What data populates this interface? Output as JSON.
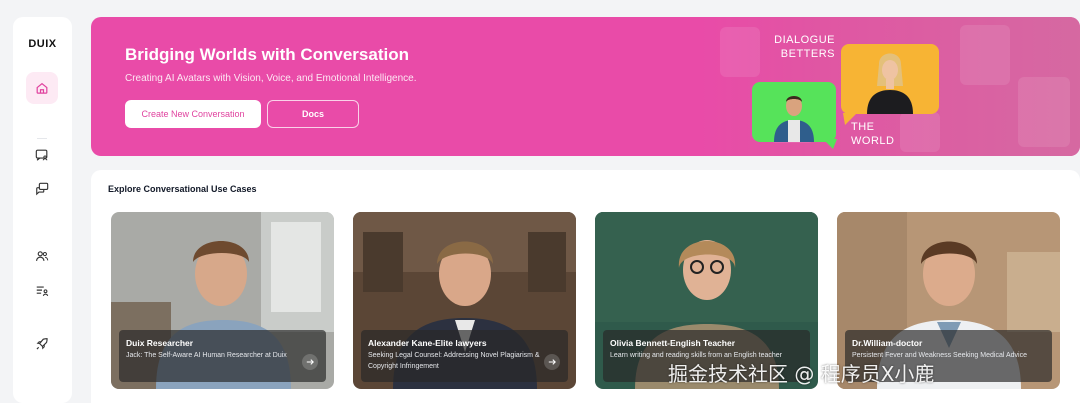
{
  "sidebar": {
    "logo": "DUIX",
    "items": [
      {
        "icon": "home-icon"
      },
      {
        "icon": "chat-avatar-icon"
      },
      {
        "icon": "chat-bubbles-icon"
      },
      {
        "icon": "users-icon"
      },
      {
        "icon": "list-user-icon"
      },
      {
        "icon": "rocket-icon"
      }
    ]
  },
  "hero": {
    "title": "Bridging Worlds with Conversation",
    "subtitle": "Creating AI Avatars with Vision, Voice, and Emotional Intelligence.",
    "primary_button": "Create New Conversation",
    "secondary_button": "Docs",
    "art_text_top_line1": "DIALOGUE",
    "art_text_top_line2": "BETTERS",
    "art_text_bottom_line1": "THE",
    "art_text_bottom_line2": "WORLD",
    "colors": {
      "background": "#e94ba8",
      "green_card": "#56e35a",
      "orange_card": "#f7b434"
    }
  },
  "use_cases": {
    "title": "Explore Conversational Use Cases",
    "cards": [
      {
        "name": "Duix Researcher",
        "description": "Jack: The Self-Aware AI Human Researcher at Duix"
      },
      {
        "name": "Alexander Kane-Elite lawyers",
        "description": "Seeking Legal Counsel: Addressing Novel Plagiarism & Copyright Infringement"
      },
      {
        "name": "Olivia Bennett-English Teacher",
        "description": "Learn writing and reading skills from an English teacher"
      },
      {
        "name": "Dr.William-doctor",
        "description": "Persistent Fever and Weakness Seeking Medical Advice"
      }
    ]
  },
  "watermark": "掘金技术社区 @ 程序员X小鹿"
}
